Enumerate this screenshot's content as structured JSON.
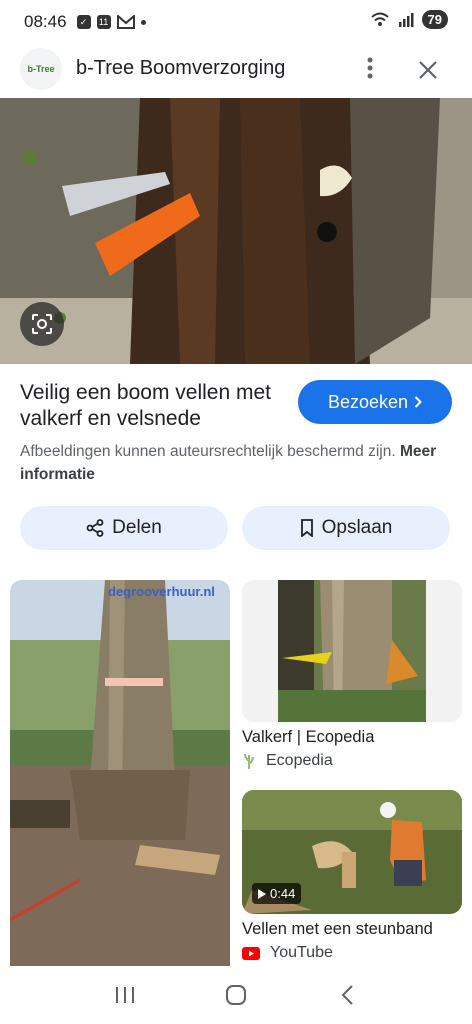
{
  "status": {
    "time": "08:46",
    "notif_count": "11",
    "battery": "79"
  },
  "header": {
    "logo_text": "b-Tree",
    "title": "b-Tree Boomverzorging"
  },
  "result": {
    "title": "Veilig een boom vellen met valkerf en velsnede",
    "visit_label": "Bezoeken",
    "copyright_text": "Afbeeldingen kunnen auteursrechtelijk beschermd zijn.",
    "more_info": "Meer informatie"
  },
  "actions": {
    "share_label": "Delen",
    "save_label": "Opslaan"
  },
  "related": [
    {
      "watermark": "degrooverhuur.nl"
    },
    {
      "title": "Valkerf | Ecopedia",
      "source": "Ecopedia"
    },
    {
      "title": "Vellen met een steunband",
      "source": "YouTube",
      "duration": "0:44"
    }
  ],
  "colors": {
    "accent": "#1a73e8",
    "chip_bg": "#e8f0fe",
    "youtube": "#ff0000"
  }
}
